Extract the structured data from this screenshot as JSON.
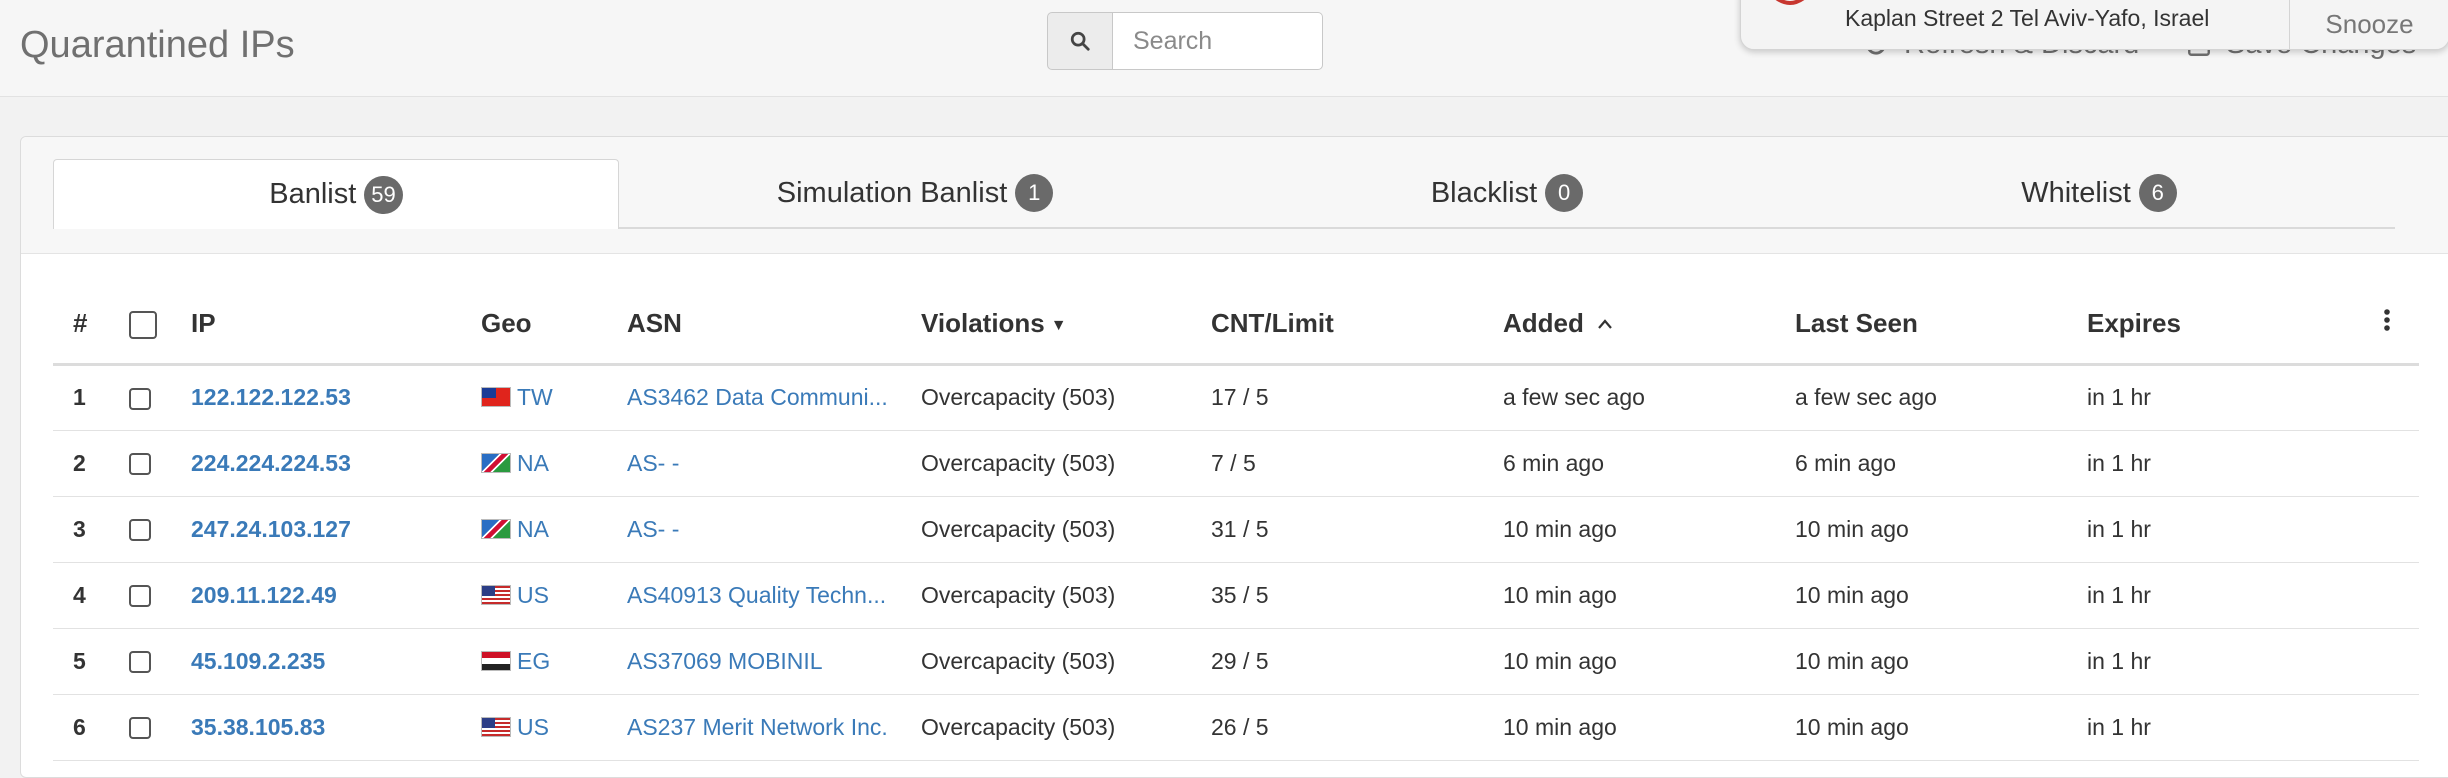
{
  "header": {
    "title": "Quarantined IPs",
    "search_placeholder": "Search",
    "refresh_label": "Refresh & Discard",
    "save_label": "Save Changes"
  },
  "notification": {
    "text": "Kaplan Street 2 Tel Aviv-Yafo, Israel",
    "snooze_label": "Snooze"
  },
  "tabs": [
    {
      "label": "Banlist",
      "count": "59",
      "active": true
    },
    {
      "label": "Simulation Banlist",
      "count": "1",
      "active": false
    },
    {
      "label": "Blacklist",
      "count": "0",
      "active": false
    },
    {
      "label": "Whitelist",
      "count": "6",
      "active": false
    }
  ],
  "table": {
    "columns": {
      "num": "#",
      "ip": "IP",
      "geo": "Geo",
      "asn": "ASN",
      "violations": "Violations",
      "cnt_limit": "CNT/Limit",
      "added": "Added",
      "last_seen": "Last Seen",
      "expires": "Expires"
    },
    "rows": [
      {
        "num": "1",
        "ip": "122.122.122.53",
        "geo": "TW",
        "asn": "AS3462 Data Communi...",
        "violations": "Overcapacity (503)",
        "cnt_limit": "17 / 5",
        "added": "a few sec ago",
        "last_seen": "a few sec ago",
        "expires": "in 1 hr"
      },
      {
        "num": "2",
        "ip": "224.224.224.53",
        "geo": "NA",
        "asn": "AS- -",
        "violations": "Overcapacity (503)",
        "cnt_limit": "7 / 5",
        "added": "6 min ago",
        "last_seen": "6 min ago",
        "expires": "in 1 hr"
      },
      {
        "num": "3",
        "ip": "247.24.103.127",
        "geo": "NA",
        "asn": "AS- -",
        "violations": "Overcapacity (503)",
        "cnt_limit": "31 / 5",
        "added": "10 min ago",
        "last_seen": "10 min ago",
        "expires": "in 1 hr"
      },
      {
        "num": "4",
        "ip": "209.11.122.49",
        "geo": "US",
        "asn": "AS40913 Quality Techn...",
        "violations": "Overcapacity (503)",
        "cnt_limit": "35 / 5",
        "added": "10 min ago",
        "last_seen": "10 min ago",
        "expires": "in 1 hr"
      },
      {
        "num": "5",
        "ip": "45.109.2.235",
        "geo": "EG",
        "asn": "AS37069 MOBINIL",
        "violations": "Overcapacity (503)",
        "cnt_limit": "29 / 5",
        "added": "10 min ago",
        "last_seen": "10 min ago",
        "expires": "in 1 hr"
      },
      {
        "num": "6",
        "ip": "35.38.105.83",
        "geo": "US",
        "asn": "AS237 Merit Network Inc.",
        "violations": "Overcapacity (503)",
        "cnt_limit": "26 / 5",
        "added": "10 min ago",
        "last_seen": "10 min ago",
        "expires": "in 1 hr"
      }
    ]
  },
  "colors": {
    "link": "#3a7ab8",
    "badge": "#6a6a6a",
    "title": "#707070"
  },
  "icons": {
    "search": "search-icon",
    "refresh": "refresh-icon",
    "save": "save-icon",
    "more": "more-vertical-icon",
    "notification": "location-pin-icon"
  }
}
